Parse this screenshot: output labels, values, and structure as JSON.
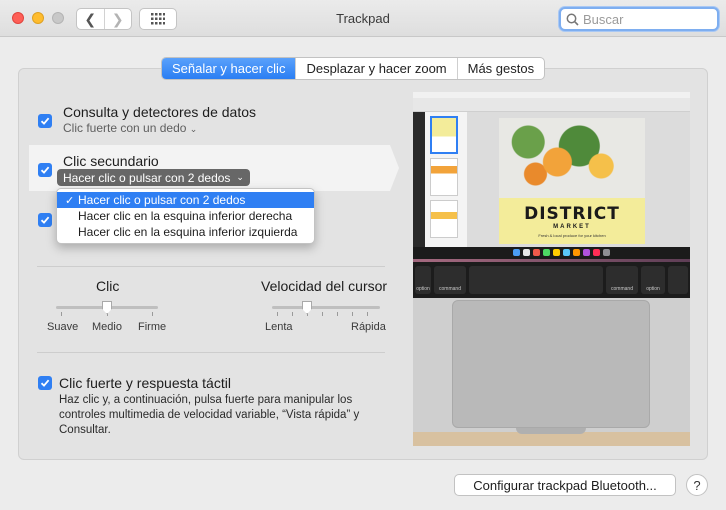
{
  "window": {
    "title": "Trackpad"
  },
  "search": {
    "placeholder": "Buscar"
  },
  "tabs": [
    {
      "label": "Señalar y hacer clic",
      "active": true
    },
    {
      "label": "Desplazar y hacer zoom",
      "active": false
    },
    {
      "label": "Más gestos",
      "active": false
    }
  ],
  "options": {
    "lookup": {
      "title": "Consulta y detectores de datos",
      "sub": "Clic fuerte con un dedo",
      "checked": true
    },
    "secondary": {
      "title": "Clic secundario",
      "value": "Hacer clic o pulsar con 2 dedos",
      "checked": true
    },
    "third": {
      "checked": true
    },
    "force": {
      "title": "Clic fuerte y respuesta táctil",
      "description": "Haz clic y, a continuación, pulsa fuerte para manipular los controles multimedia de velocidad variable, “Vista rápida” y Consultar.",
      "checked": true
    }
  },
  "dropdown": {
    "items": [
      {
        "label": "Hacer clic o pulsar con 2 dedos",
        "selected": true
      },
      {
        "label": "Hacer clic en la esquina inferior derecha",
        "selected": false
      },
      {
        "label": "Hacer clic en la esquina inferior izquierda",
        "selected": false
      }
    ]
  },
  "sliders": {
    "click": {
      "label": "Clic",
      "ticks": [
        "Suave",
        "Medio",
        "Firme"
      ],
      "value": "Medio"
    },
    "speed": {
      "label": "Velocidad del cursor",
      "ticks": [
        "Lenta",
        "Rápida"
      ],
      "value_fraction": 0.35
    }
  },
  "preview": {
    "doc_title": "DISTRICT",
    "doc_subtitle": "MARKET",
    "doc_tagline": "Fresh & local produce for your kitchen",
    "key_left": "command",
    "key_left_outer": "option",
    "key_right": "command",
    "key_right_outer": "option"
  },
  "footer": {
    "bluetooth_button": "Configurar trackpad Bluetooth...",
    "help": "?"
  },
  "colors": {
    "accent": "#2f7ff3",
    "close": "#fe5f57",
    "minimize": "#febc2e"
  }
}
